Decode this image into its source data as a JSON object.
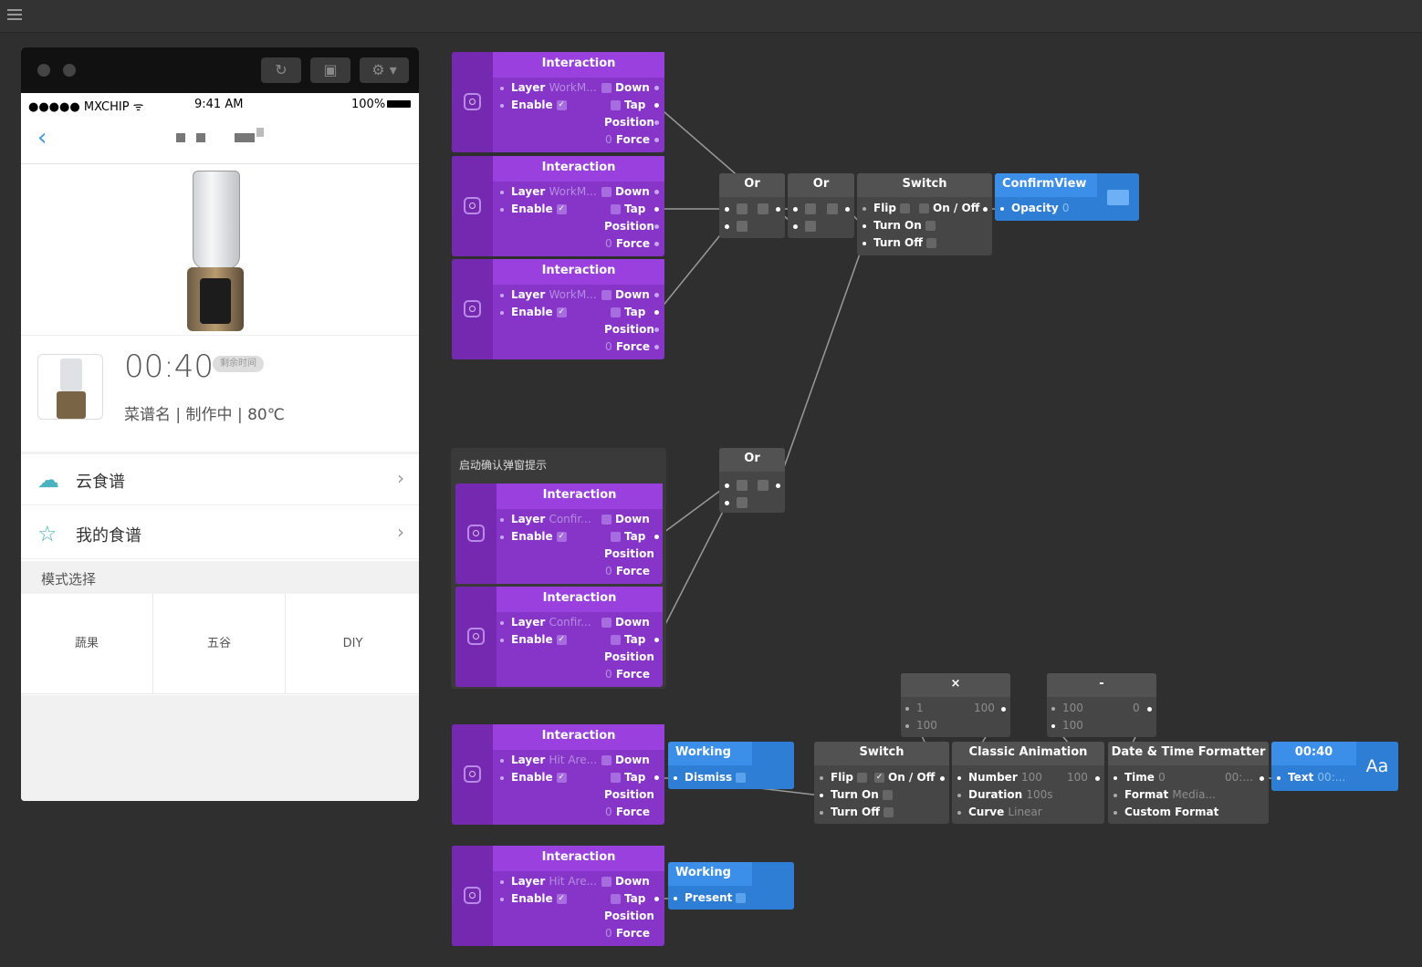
{
  "topbar": {
    "menu_icon": "hamburger-icon"
  },
  "phone": {
    "window_buttons": [
      "reload-icon",
      "video-icon",
      "gear-icon"
    ],
    "status": {
      "carrier": "●●●●● MXCHIP ᯤ",
      "time": "9:41 AM",
      "battery": "100%"
    },
    "nav": {
      "back": "‹"
    },
    "info": {
      "timer": "00:40",
      "tag": "剩余时间",
      "subtitle": "菜谱名 | 制作中 | 80℃"
    },
    "menu": [
      {
        "label": "云食谱",
        "icon": "cloud-icon"
      },
      {
        "label": "我的食谱",
        "icon": "star-icon"
      }
    ],
    "mode_title": "模式选择",
    "modes": [
      "蔬果",
      "五谷",
      "DIY"
    ]
  },
  "patches": {
    "interaction_title": "Interaction",
    "layer_label": "Layer",
    "enable_label": "Enable",
    "down_label": "Down",
    "tap_label": "Tap",
    "position_label": "Position",
    "force_label": "Force",
    "force_value": "0",
    "layers": [
      "WorkM...",
      "WorkM...",
      "WorkM...",
      "Confir...",
      "Confir...",
      "Hit Are...",
      "Hit Are..."
    ],
    "group_title": "启动确认弹窗提示",
    "or_title": "Or",
    "switch_title": "Switch",
    "flip": "Flip",
    "onoff": "On / Off",
    "turnon": "Turn On",
    "turnoff": "Turn Off",
    "confirm_title": "ConfirmView",
    "opacity": "Opacity",
    "opacity_value": "0",
    "working_title": "Working",
    "dismiss": "Dismiss",
    "present": "Present",
    "mult_title": "×",
    "minus_title": "-",
    "mult_in1": "1",
    "mult_in2": "100",
    "mult_out": "100",
    "minus_in1": "100",
    "minus_in2": "100",
    "minus_out": "0",
    "anim_title": "Classic Animation",
    "number": "Number",
    "number_value": "100",
    "number_out": "100",
    "duration": "Duration",
    "duration_value": "100s",
    "curve": "Curve",
    "curve_value": "Linear",
    "date_title": "Date & Time Formatter",
    "time": "Time",
    "time_value": "0",
    "time_out": "00:...",
    "format": "Format",
    "format_value": "Media...",
    "custom": "Custom Format",
    "text_title": "00:40",
    "text": "Text",
    "text_value": "00:...",
    "text_icon": "Aa"
  },
  "colors": {
    "interaction": "#8735c9",
    "layer": "#2f7ed6",
    "logic": "#464646",
    "background": "#2f2f2f"
  }
}
